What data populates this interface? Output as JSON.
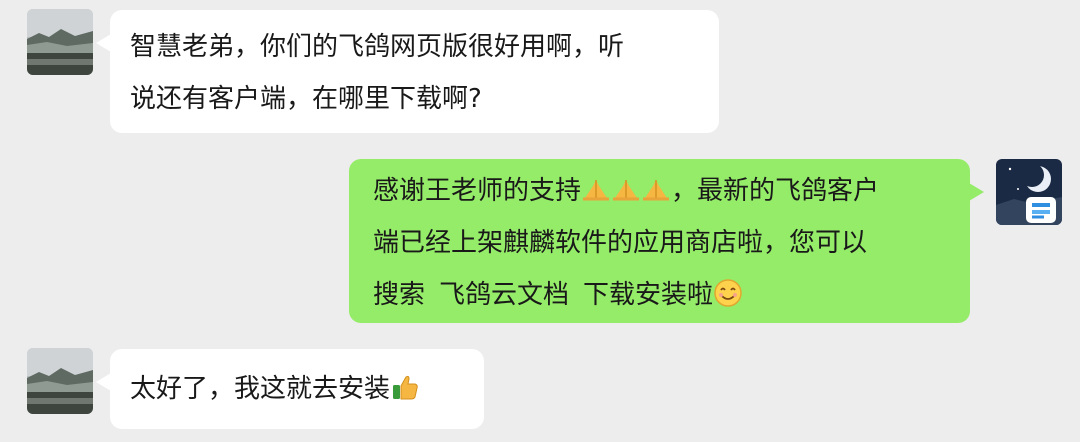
{
  "conversation": {
    "messages": [
      {
        "sender": "other",
        "lines": [
          "智慧老弟，你们的飞鸽网页版很好用啊，听",
          "说还有客户端，在哪里下载啊?"
        ]
      },
      {
        "sender": "me",
        "line1_a": "感谢王老师的支持",
        "line1_b": "，最新的飞鸽客户",
        "line2": "端已经上架麒麟软件的应用商店啦，您可以",
        "line3_a": "搜索",
        "line3_b": "飞鸽云文档",
        "line3_c": "下载安装啦"
      },
      {
        "sender": "other",
        "text": "太好了，我这就去安装"
      }
    ]
  },
  "icons": {
    "other_avatar": "landscape-avatar-icon",
    "my_avatar": "night-moon-app-avatar-icon",
    "pray": "folded-hands-emoji-icon",
    "smile": "smiling-face-emoji-icon",
    "thumbs_up": "thumbs-up-emoji-icon"
  },
  "colors": {
    "background": "#ededed",
    "incoming_bubble": "#ffffff",
    "outgoing_bubble": "#95ec69",
    "text": "#191919"
  }
}
